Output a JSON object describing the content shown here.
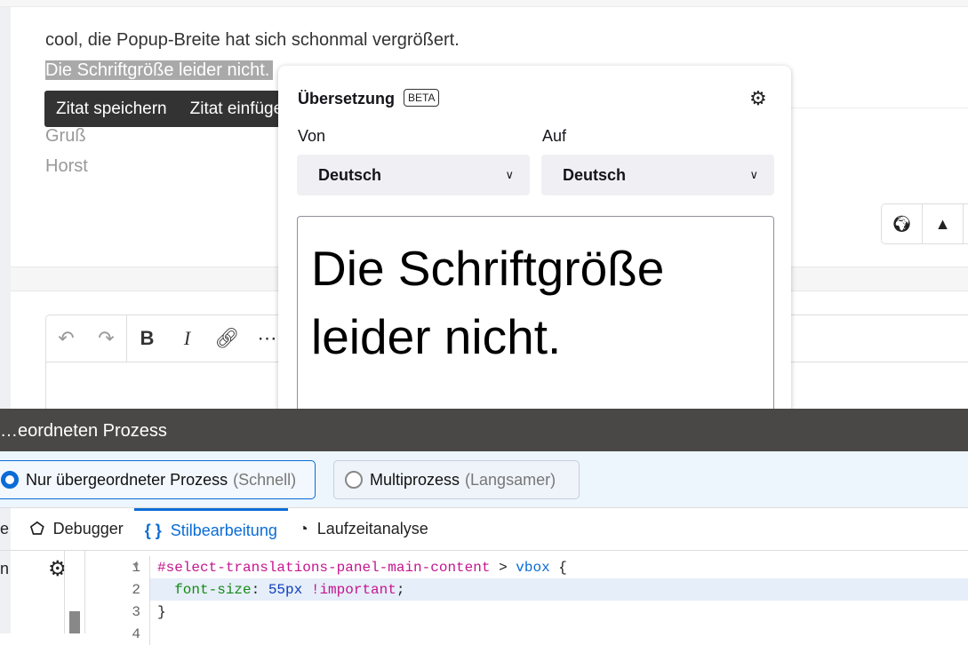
{
  "post": {
    "line1": "cool, die Popup-Breite hat sich schonmal vergrößert.",
    "line2": "Die Schriftgröße leider nicht.",
    "greeting": "Gruß",
    "name": "Horst"
  },
  "quote_toolbar": {
    "save": "Zitat speichern",
    "insert": "Zitat einfügen"
  },
  "translation": {
    "title": "Übersetzung",
    "badge": "BETA",
    "from_label": "Von",
    "to_label": "Auf",
    "from_value": "Deutsch",
    "to_value": "Deutsch",
    "result": "Die Schriftgröße leider nicht."
  },
  "devtools": {
    "title": "…eordneten Prozess",
    "radios": [
      {
        "label": "Nur übergeordneter Prozess",
        "hint": "(Schnell)",
        "checked": true
      },
      {
        "label": "Multiprozess",
        "hint": "(Langsamer)",
        "checked": false
      }
    ],
    "tabs": [
      {
        "label": "e"
      },
      {
        "label": "Debugger"
      },
      {
        "label": "Stilbearbeitung",
        "active": true
      },
      {
        "label": "Laufzeitanalyse"
      }
    ],
    "side_text": "n",
    "code": {
      "selector": "#select-translations-panel-main-content",
      "combinator": ">",
      "element": "vbox",
      "property": "font-size",
      "value": "55px",
      "important": "!important",
      "line_numbers": [
        "1",
        "2",
        "3",
        "4"
      ]
    }
  },
  "colors": {
    "accent": "#0a6cd6",
    "devtools_bar": "#4a4846"
  }
}
